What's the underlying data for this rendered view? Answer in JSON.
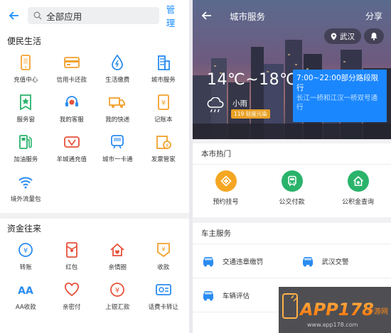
{
  "left": {
    "search_placeholder": "全部应用",
    "manage": "管理",
    "sections": [
      {
        "title": "便民生活",
        "items": [
          {
            "label": "充值中心",
            "icon": "phone-icon"
          },
          {
            "label": "信用卡还款",
            "icon": "credit-card-icon"
          },
          {
            "label": "生活缴费",
            "icon": "utility-drop-icon"
          },
          {
            "label": "城市服务",
            "icon": "city-building-icon"
          },
          {
            "label": "服务窗",
            "icon": "service-window-icon"
          },
          {
            "label": "我的客服",
            "icon": "headset-icon"
          },
          {
            "label": "我的快递",
            "icon": "truck-icon"
          },
          {
            "label": "记账本",
            "icon": "ledger-icon"
          },
          {
            "label": "加油服务",
            "icon": "fuel-icon"
          },
          {
            "label": "羊城通充值",
            "icon": "transit-card-icon"
          },
          {
            "label": "城市一卡通",
            "icon": "city-card-icon"
          },
          {
            "label": "发票管家",
            "icon": "invoice-icon"
          },
          {
            "label": "境外流量包",
            "icon": "wifi-icon"
          }
        ]
      },
      {
        "title": "资金往来",
        "items": [
          {
            "label": "转账",
            "icon": "transfer-icon"
          },
          {
            "label": "红包",
            "icon": "red-packet-icon"
          },
          {
            "label": "亲情圈",
            "icon": "family-home-icon"
          },
          {
            "label": "收款",
            "icon": "receive-money-icon"
          },
          {
            "label": "AA收款",
            "icon": "aa-icon"
          },
          {
            "label": "亲密付",
            "icon": "heart-pay-icon"
          },
          {
            "label": "上银汇款",
            "icon": "bank-remit-icon"
          },
          {
            "label": "话费卡转让",
            "icon": "phone-card-icon"
          }
        ]
      }
    ]
  },
  "right": {
    "title": "城市服务",
    "share": "分享",
    "location": "武汉",
    "temp": "14℃~18℃",
    "weather": "小雨",
    "aqi": "119 轻度污染",
    "limit_line1": "7:00~22:00部分路段限行",
    "limit_line2": "长江一桥和江汉一桥双号通行",
    "hot_title": "本市热门",
    "hot": [
      {
        "label": "预约挂号",
        "color": "#f5a623"
      },
      {
        "label": "公交付款",
        "color": "#2ab36b"
      },
      {
        "label": "公积金查询",
        "color": "#2ab36b"
      }
    ],
    "car_title": "车主服务",
    "car": [
      {
        "label": "交通违章缴罚"
      },
      {
        "label": "武汉交警"
      },
      {
        "label": "车辆评估"
      }
    ]
  },
  "watermark": {
    "text_main": "APP178",
    "text_sub": "手游网",
    "url": "www.app178.com"
  },
  "colors": {
    "accent": "#1a8dff",
    "icon_blue": "#2a8cf0",
    "icon_orange": "#f2a12e",
    "icon_red": "#e8513a",
    "icon_green": "#2ab36b"
  }
}
